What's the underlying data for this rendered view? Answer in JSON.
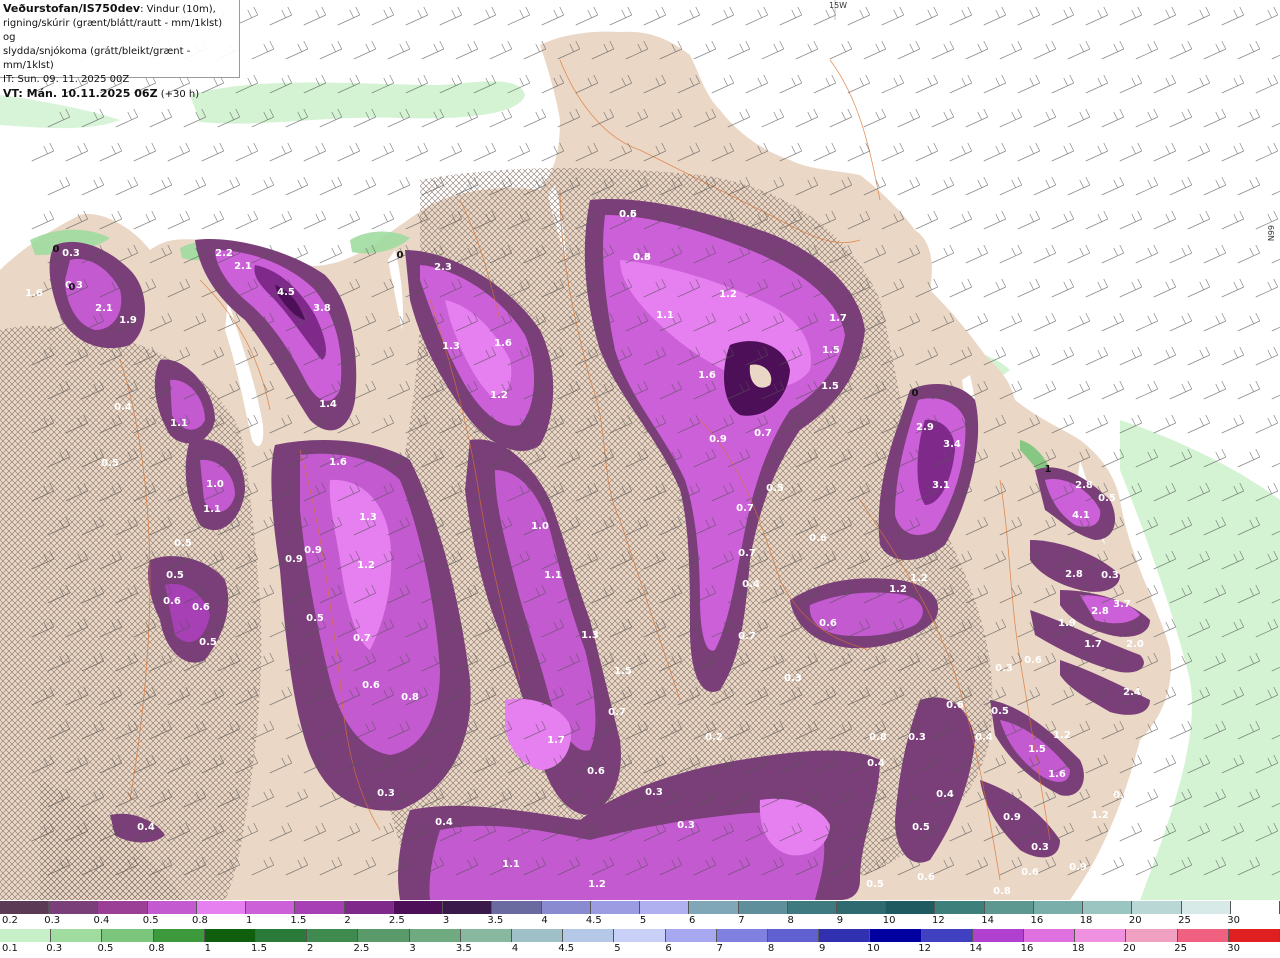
{
  "header": {
    "source": "Veðurstofan/IS750dev",
    "description_1": ": Vindur (10m),",
    "description_2": "rigning/skúrir (grænt/blátt/rautt - mm/1klst) og",
    "description_3": "slydda/snjókoma (grátt/bleikt/grænt - mm/1klst)",
    "issue_time": "IT: Sun. 09. 11. 2025 00Z",
    "valid_time": "VT: Mán. 10.11.2025 06Z",
    "lead_time": "(+30 h)"
  },
  "grid_labels": {
    "lon": "15W",
    "lat": "66N"
  },
  "colors": {
    "sea": "#ffffff",
    "land": "#ead7c6",
    "barb": "#555555",
    "road": "#d9722e"
  },
  "value_labels": [
    "0.6",
    "0.6",
    "1.2",
    "1.1",
    "1.7",
    "1.5",
    "1.5",
    "1.6",
    "0.9",
    "0.7",
    "0.5",
    "0.7",
    "0.6",
    "0.7",
    "0.4",
    "0.7",
    "2.3",
    "1.3",
    "1.6",
    "1.2",
    "1.0",
    "1.1",
    "1.3",
    "1.5",
    "0.7",
    "1.7",
    "0.6",
    "0.3",
    "0.2",
    "0.3",
    "0.3",
    "2.2",
    "2.1",
    "4.5",
    "3.8",
    "1.4",
    "1.6",
    "1.3",
    "0.9",
    "1.2",
    "0.9",
    "0.5",
    "0.7",
    "0.6",
    "0.8",
    "0.3",
    "0.4",
    "1.1",
    "1.2",
    "0.3",
    "1.6",
    "2.1",
    "1.9",
    "0.3",
    "0.4",
    "1.1",
    "1.0",
    "1.1",
    "0.5",
    "0.5",
    "0.6",
    "0.6",
    "0.5",
    "0.5",
    "0.4",
    "2.9",
    "3.4",
    "3.1",
    "1.2",
    "1.2",
    "0.6",
    "0.3",
    "2.8",
    "4.1",
    "2.8",
    "3.7",
    "2.8",
    "1.9",
    "1.7",
    "2.0",
    "2.4",
    "0.6",
    "0.3",
    "0.5",
    "0.3",
    "1.2",
    "1.5",
    "1.6",
    "0.5",
    "0.4",
    "0.3",
    "0.4",
    "0.4",
    "0.5",
    "0.9",
    "0.3",
    "0.6",
    "0.6",
    "0.8",
    "0.5",
    "1.2",
    "0.9",
    "0.8",
    "0.6",
    "0.5",
    "0.5",
    "0.3"
  ],
  "contour_zero_labels": [
    "0",
    "0",
    "0",
    "0",
    "1"
  ],
  "legend_snow": {
    "labels": [
      "0.2",
      "0.3",
      "0.4",
      "0.5",
      "0.8",
      "1",
      "1.5",
      "2",
      "2.5",
      "3",
      "3.5",
      "4",
      "4.5",
      "5",
      "6",
      "7",
      "8",
      "9",
      "10",
      "12",
      "14",
      "16",
      "18",
      "20",
      "25",
      "30"
    ],
    "colors": [
      "#5a3a55",
      "#7a3f78",
      "#9a3e96",
      "#c35ad0",
      "#e67ff0",
      "#cc60d8",
      "#a640b4",
      "#7f2a8a",
      "#4d0f57",
      "#3a1a4a",
      "#6a6aa0",
      "#8a8ad0",
      "#9c9ce2",
      "#b0b0f0",
      "#7fa7b8",
      "#5f8f9a",
      "#3f7a80",
      "#2f6a70",
      "#1f5a60",
      "#3d7f7a",
      "#5c9790",
      "#7aaeaa",
      "#9bc5c1",
      "#b9d8d5",
      "#d7eae8",
      "#ffffff"
    ]
  },
  "legend_rain": {
    "labels": [
      "0.1",
      "0.3",
      "0.5",
      "0.8",
      "1",
      "1.5",
      "2",
      "2.5",
      "3",
      "3.5",
      "4",
      "4.5",
      "5",
      "6",
      "7",
      "8",
      "9",
      "10",
      "12",
      "14",
      "16",
      "18",
      "20",
      "25",
      "30"
    ],
    "colors": [
      "#c8f0c8",
      "#a0dca0",
      "#7cc57c",
      "#3c9a3c",
      "#0f5f0f",
      "#2a7a3a",
      "#3f8a4f",
      "#5a9a6a",
      "#6faa80",
      "#88b8a0",
      "#a0c0c8",
      "#b6c8e8",
      "#c8d0f8",
      "#a8a8f0",
      "#8080e0",
      "#6060d0",
      "#3030b0",
      "#0000a0",
      "#4040c0",
      "#b040d0",
      "#e070e0",
      "#f090e0",
      "#f0a0c0",
      "#f06080",
      "#e02020"
    ]
  }
}
